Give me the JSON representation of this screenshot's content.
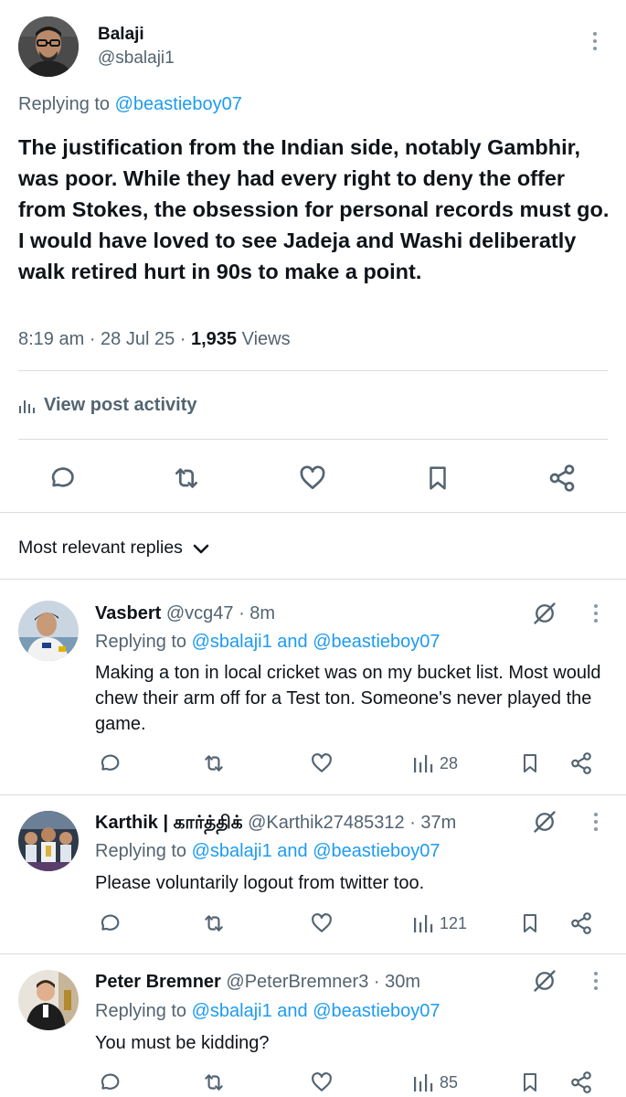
{
  "main_post": {
    "author_name": "Balaji",
    "author_handle": "@sbalaji1",
    "replying_prefix": "Replying to",
    "replying_to": "@beastieboy07",
    "text": "The justification from the Indian side, notably Gambhir, was poor. While they had every right to deny the offer from Stokes, the obsession for personal records must go. I would have loved to see Jadeja and Washi deliberatly walk retired hurt in 90s to make a point.",
    "time": "8:19 am",
    "date": "28 Jul 25",
    "views_count": "1,935",
    "views_label": "Views",
    "activity_label": "View post activity"
  },
  "replies_header": {
    "label": "Most relevant replies"
  },
  "replies": [
    {
      "name": "Vasbert",
      "handle": "@vcg47",
      "time": "8m",
      "replying_prefix": "Replying to",
      "replying_to": "@sbalaji1 and @beastieboy07",
      "text": "Making a ton in local cricket was on my bucket list. Most would chew their arm off for a Test ton. Someone's never played the game.",
      "views": "28"
    },
    {
      "name": "Karthik | கார்த்திக்",
      "handle": "@Karthik27485312",
      "time": "37m",
      "replying_prefix": "Replying to",
      "replying_to": "@sbalaji1 and @beastieboy07",
      "text": "Please voluntarily logout from twitter too.",
      "views": "121"
    },
    {
      "name": "Peter Bremner",
      "handle": "@PeterBremner3",
      "time": "30m",
      "replying_prefix": "Replying to",
      "replying_to": "@sbalaji1 and @beastieboy07",
      "text": "You must be kidding?",
      "views": "85"
    }
  ],
  "colors": {
    "link": "#1d9bf0",
    "muted": "#536471",
    "text": "#0f1419",
    "divider": "#d9dde1"
  },
  "icons": [
    "reply-icon",
    "retweet-icon",
    "like-icon",
    "bookmark-icon",
    "share-icon",
    "views-icon",
    "grok-icon",
    "more-icon",
    "chevron-down-icon"
  ]
}
